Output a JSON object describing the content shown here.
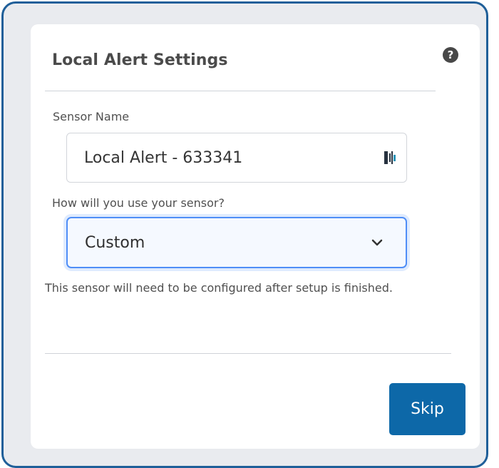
{
  "dialog": {
    "title": "Local Alert Settings",
    "help_icon": "question-circle-icon",
    "help_glyph": "?"
  },
  "sensor_name": {
    "label": "Sensor Name",
    "value": "Local Alert - 633341",
    "tool_icon": "input-tool-icon"
  },
  "usage": {
    "label": "How will you use your sensor?",
    "selected": "Custom",
    "chevron_icon": "chevron-down-icon"
  },
  "message": "This sensor will need to be configured after setup is finished.",
  "actions": {
    "skip_label": "Skip"
  },
  "colors": {
    "frame_border": "#1f5f99",
    "frame_background": "#e9ebef",
    "select_focus": "#4f8ef7",
    "skip_button": "#0d68a8"
  }
}
